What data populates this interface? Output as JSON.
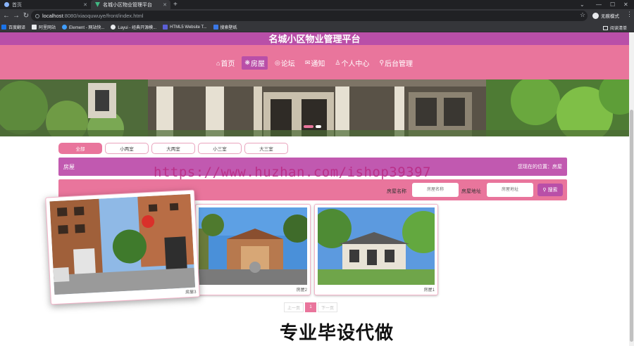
{
  "browser": {
    "tabs": [
      {
        "label": "首页"
      },
      {
        "label": "名城小区物业管理平台"
      }
    ],
    "new_tab": "+",
    "url_host": "localhost",
    "url_path": ":8080/xiaoquwuye/front/index.html",
    "profile": "无痕模式",
    "bookmarks": [
      "百度翻译",
      "阿里网站",
      "Element - 网站快...",
      "Layui - 经典开源模...",
      "HTML5 Website T...",
      "搜索壁纸"
    ],
    "reading_list": "阅读清单"
  },
  "site": {
    "title": "名城小区物业管理平台",
    "nav": [
      {
        "icon": "home-icon",
        "label": "首页"
      },
      {
        "icon": "building-icon",
        "label": "房屋"
      },
      {
        "icon": "forum-icon",
        "label": "论坛"
      },
      {
        "icon": "notice-icon",
        "label": "通知"
      },
      {
        "icon": "user-icon",
        "label": "个人中心"
      },
      {
        "icon": "link-icon",
        "label": "后台管理"
      }
    ],
    "active_nav": "房屋"
  },
  "filters": [
    "全部",
    "小两室",
    "大两室",
    "小三室",
    "大三室"
  ],
  "active_filter": "全部",
  "crumb": {
    "section": "房屋",
    "location": "您现在的位置：房屋"
  },
  "search": {
    "name_label": "房屋名称",
    "name_placeholder": "房屋名称",
    "addr_label": "房屋地址",
    "addr_placeholder": "房屋地址",
    "button": "搜索"
  },
  "cards": [
    {
      "caption": "房屋3"
    },
    {
      "caption": "房屋2"
    },
    {
      "caption": "房屋1"
    }
  ],
  "pager": {
    "prev": "上一页",
    "page": "1",
    "next": "下一页"
  },
  "overlay": {
    "watermark": "https://www.huzhan.com/ishop39397",
    "slogan": "专业毕设代做"
  },
  "colors": {
    "primary": "#e9759c",
    "accent": "#b94fa8"
  }
}
